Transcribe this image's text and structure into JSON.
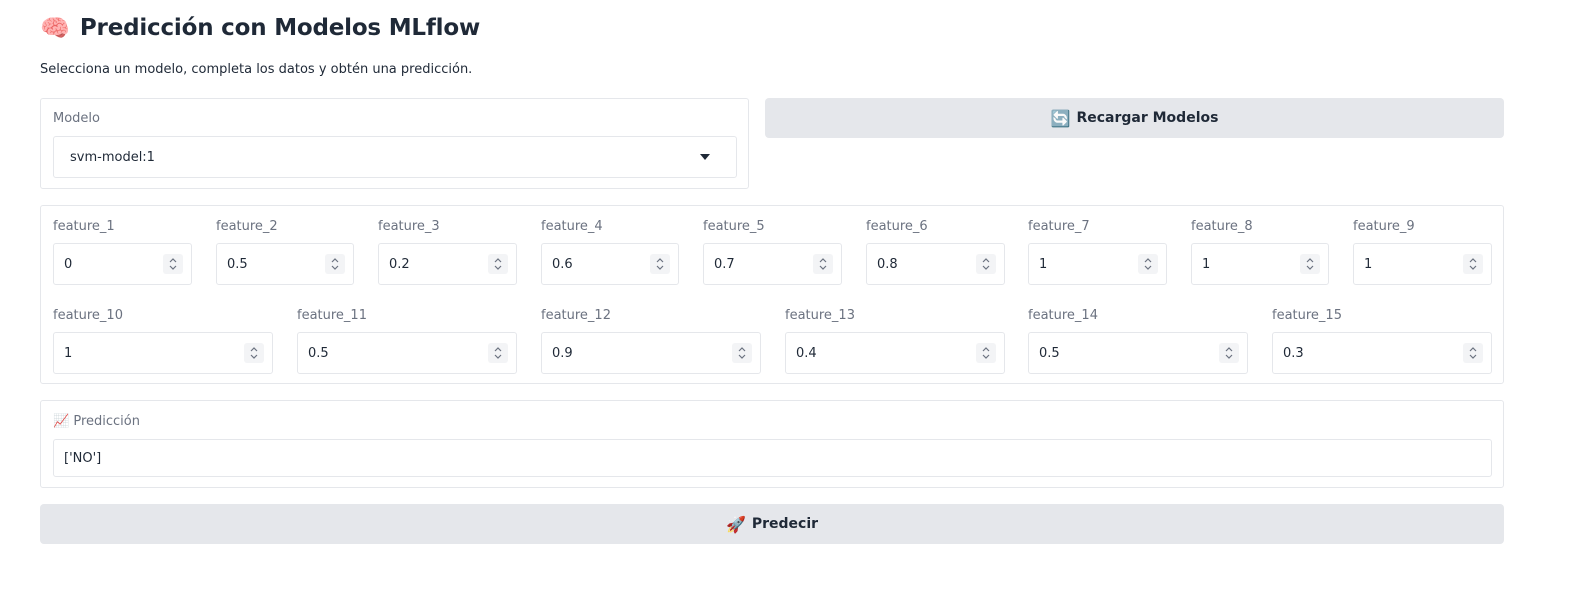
{
  "header": {
    "icon": "brain-icon",
    "icon_glyph": "🧠",
    "title": "Predicción con Modelos MLflow",
    "subtitle": "Selecciona un modelo, completa los datos y obtén una predicción."
  },
  "model_select": {
    "label": "Modelo",
    "value": "svm-model:1"
  },
  "reload_button": {
    "icon": "refresh-icon",
    "icon_glyph": "🔄",
    "label": "Recargar Modelos"
  },
  "features": [
    {
      "label": "feature_1",
      "value": "0"
    },
    {
      "label": "feature_2",
      "value": "0.5"
    },
    {
      "label": "feature_3",
      "value": "0.2"
    },
    {
      "label": "feature_4",
      "value": "0.6"
    },
    {
      "label": "feature_5",
      "value": "0.7"
    },
    {
      "label": "feature_6",
      "value": "0.8"
    },
    {
      "label": "feature_7",
      "value": "1"
    },
    {
      "label": "feature_8",
      "value": "1"
    },
    {
      "label": "feature_9",
      "value": "1"
    },
    {
      "label": "feature_10",
      "value": "1"
    },
    {
      "label": "feature_11",
      "value": "0.5"
    },
    {
      "label": "feature_12",
      "value": "0.9"
    },
    {
      "label": "feature_13",
      "value": "0.4"
    },
    {
      "label": "feature_14",
      "value": "0.5"
    },
    {
      "label": "feature_15",
      "value": "0.3"
    }
  ],
  "prediction": {
    "icon": "chart-increasing-icon",
    "icon_glyph": "📈",
    "label": "Predicción",
    "value": "['NO']"
  },
  "predict_button": {
    "icon": "rocket-icon",
    "icon_glyph": "🚀",
    "label": "Predecir"
  },
  "colors": {
    "button_bg": "#e5e7eb",
    "border": "#e5e7eb",
    "label_text": "#6b7280",
    "text": "#1f2937"
  }
}
